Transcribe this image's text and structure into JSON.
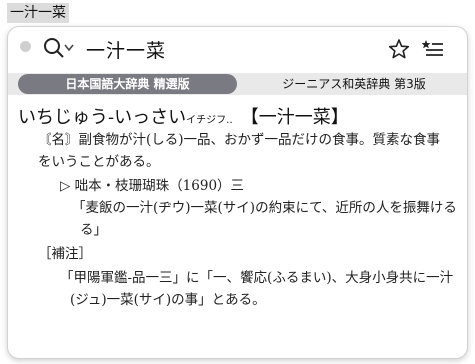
{
  "top_chip": "一汁一菜",
  "search": {
    "query": "一汁一菜"
  },
  "icons": {
    "search": "search-icon",
    "star": "star-icon",
    "list": "list-icon",
    "status_dot": "status-dot"
  },
  "tabs": [
    {
      "label": "日本国語大辞典 精選版",
      "active": true
    },
    {
      "label": "ジーニアス和英辞典 第3版",
      "active": false
    }
  ],
  "entry": {
    "reading": "いちじゅう-いっさい",
    "reading_alt": "イチジフ‥",
    "headword": "【一汁一菜】",
    "def_line1": "〘名〙副食物が汁(しる)一品、おかず一品だけの食事。質素な食事",
    "def_line2": "をいうことがある。",
    "citation_source": "▷ 咄本・枝珊瑚珠（1690）三",
    "quote_line1": "「麦飯の一汁(ヂウ)一菜(サイ)の約束にて、近所の人を振舞ける",
    "quote_line2": "る」",
    "note_label": "［補注］",
    "note_line1": "「甲陽軍鑑-品一三」に「一、饗応(ふるまい)、大身小身共に一汁",
    "note_line2": "(ジュ)一菜(サイ)の事」とある。"
  }
}
